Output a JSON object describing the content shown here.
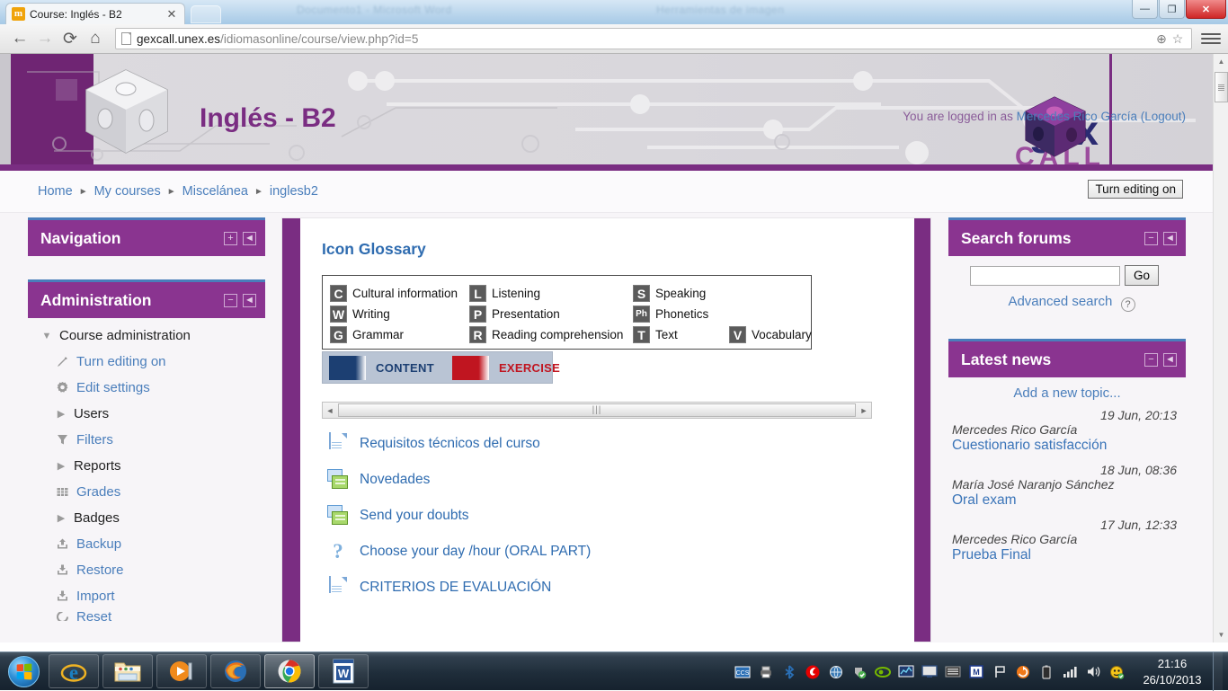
{
  "browser": {
    "tab_title": "Course: Inglés - B2",
    "tab_close": "✕",
    "url_dark": "gexcall.unex.es",
    "url_grey": "/idiomasonline/course/view.php?id=5",
    "back_icon": "←",
    "forward_icon": "→",
    "reload_icon": "⟳",
    "home_icon": "⌂",
    "zoom_icon": "⊕",
    "star_icon": "☆",
    "ghost_title_1": "Documento1 - Microsoft Word",
    "ghost_title_2": "Herramientas de imagen",
    "window_minimize": "—",
    "window_restore": "❐",
    "window_close": "✕"
  },
  "header": {
    "course_title": "Inglés - B2",
    "logo_gex": "gex",
    "logo_call": "CALL",
    "login_prefix": "You are logged in as ",
    "login_user": "Mercedes Rico García",
    "login_logout": " (Logout)"
  },
  "breadcrumb": {
    "items": [
      "Home",
      "My courses",
      "Miscelánea",
      "inglesb2"
    ],
    "separator": "►",
    "edit_button": "Turn editing on"
  },
  "left_blocks": [
    {
      "title": "Navigation",
      "expand_icon": "+",
      "dock_icon": "◄",
      "items": []
    },
    {
      "title": "Administration",
      "expand_icon": "−",
      "dock_icon": "◄",
      "items": [
        {
          "label": "Course administration",
          "icon": "triangle-down-icon",
          "style": "dark",
          "indent": false
        },
        {
          "label": "Turn editing on",
          "icon": "pencil-icon",
          "style": "link",
          "indent": true
        },
        {
          "label": "Edit settings",
          "icon": "gear-icon",
          "style": "link",
          "indent": true
        },
        {
          "label": "Users",
          "icon": "triangle-right-icon",
          "style": "dark",
          "indent": true
        },
        {
          "label": "Filters",
          "icon": "funnel-icon",
          "style": "link",
          "indent": true
        },
        {
          "label": "Reports",
          "icon": "triangle-right-icon",
          "style": "dark",
          "indent": true
        },
        {
          "label": "Grades",
          "icon": "grid-icon",
          "style": "link",
          "indent": true
        },
        {
          "label": "Badges",
          "icon": "triangle-right-icon",
          "style": "dark",
          "indent": true
        },
        {
          "label": "Backup",
          "icon": "upload-icon",
          "style": "link",
          "indent": true
        },
        {
          "label": "Restore",
          "icon": "download-icon",
          "style": "link",
          "indent": true
        },
        {
          "label": "Import",
          "icon": "download-icon",
          "style": "link",
          "indent": true
        },
        {
          "label": "Reset",
          "icon": "reset-icon",
          "style": "link",
          "indent": true
        }
      ]
    }
  ],
  "main": {
    "glossary_title": "Icon Glossary",
    "glossary_columns": [
      [
        {
          "badge": "C",
          "label": "Cultural information"
        },
        {
          "badge": "W",
          "label": "Writing"
        },
        {
          "badge": "G",
          "label": "Grammar"
        }
      ],
      [
        {
          "badge": "L",
          "label": "Listening"
        },
        {
          "badge": "P",
          "label": "Presentation"
        },
        {
          "badge": "R",
          "label": "Reading comprehension"
        }
      ],
      [
        {
          "badge": "S",
          "label": "Speaking"
        },
        {
          "badge": "Ph",
          "label": "Phonetics"
        },
        {
          "badge": "T",
          "label": "Text"
        }
      ],
      [
        {
          "badge": "V",
          "label": "Vocabulary"
        }
      ]
    ],
    "legend": [
      {
        "label": "CONTENT",
        "color": "#1c3f72"
      },
      {
        "label": "EXERCISE",
        "color": "#c01520"
      }
    ],
    "scroll_thumb_grip": "|||",
    "scroll_left_arrow": "◄",
    "scroll_right_arrow": "►",
    "activities": [
      {
        "label": "Requisitos técnicos del curso",
        "icon": "page-icon"
      },
      {
        "label": "Novedades",
        "icon": "forum-icon"
      },
      {
        "label": "Send your doubts",
        "icon": "forum-icon"
      },
      {
        "label": "Choose your day /hour (ORAL PART)",
        "icon": "choice-question-icon"
      },
      {
        "label": "CRITERIOS DE EVALUACIÓN",
        "icon": "page-icon"
      }
    ]
  },
  "right_blocks": {
    "search": {
      "title": "Search forums",
      "collapse_icon": "−",
      "dock_icon": "◄",
      "input_value": "",
      "input_placeholder": "",
      "go_button": "Go",
      "advanced_link": "Advanced search",
      "help_icon": "?"
    },
    "news": {
      "title": "Latest news",
      "collapse_icon": "−",
      "dock_icon": "◄",
      "add_topic": "Add a new topic...",
      "items": [
        {
          "date": "19 Jun, 20:13",
          "author": "Mercedes Rico García",
          "subject": "Cuestionario satisfacción"
        },
        {
          "date": "18 Jun, 08:36",
          "author": "María José Naranjo Sánchez",
          "subject": "Oral exam"
        },
        {
          "date": "17 Jun, 12:33",
          "author": "Mercedes Rico García",
          "subject": "Prueba Final"
        }
      ]
    }
  },
  "scrollbars": {
    "up_arrow": "▲",
    "down_arrow": "▼",
    "left_arrow": "◄",
    "right_arrow": "►",
    "thumb_grip": "|||"
  },
  "taskbar": {
    "start_label": "start-orb",
    "items": [
      {
        "name": "internet-explorer-icon",
        "state": "pinned"
      },
      {
        "name": "file-explorer-icon",
        "state": "pinned"
      },
      {
        "name": "media-player-icon",
        "state": "pinned"
      },
      {
        "name": "firefox-icon",
        "state": "pinned"
      },
      {
        "name": "chrome-icon",
        "state": "active"
      },
      {
        "name": "word-icon",
        "state": "pinned"
      }
    ],
    "tray_icons": [
      "ccs-icon",
      "printer-icon",
      "bluetooth-icon",
      "vodafone-icon",
      "globe-icon",
      "shield-check-icon",
      "nvidia-icon",
      "network-monitor-icon",
      "display-icon",
      "keyboard-icon",
      "m-icon",
      "flag-icon",
      "update-icon",
      "battery-icon",
      "signal-icon",
      "volume-icon",
      "antivirus-icon"
    ],
    "clock_time": "21:16",
    "clock_date": "26/10/2013"
  },
  "colors": {
    "purple_header": "#8a3490",
    "purple_dark": "#7a2d82",
    "link_blue": "#4a7ebb",
    "heading_blue": "#2f6cb0",
    "content_navy": "#1c3f72",
    "exercise_red": "#c01520"
  }
}
